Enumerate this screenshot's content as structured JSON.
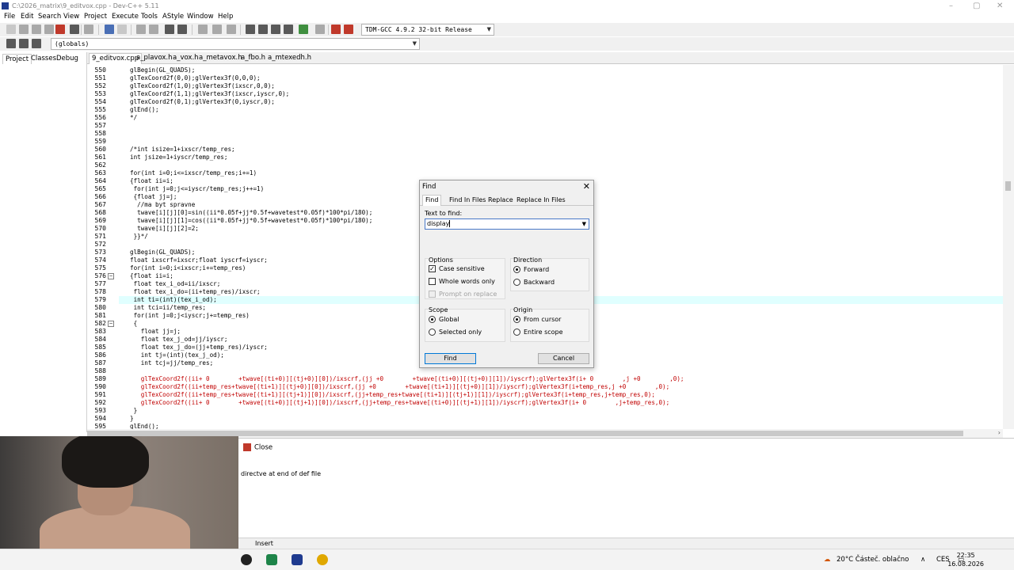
{
  "window": {
    "title": "C:\\2026_matrix\\9_editvox.cpp - Dev-C++ 5.11",
    "controls": [
      "–",
      "▢",
      "✕"
    ]
  },
  "menu": [
    "File",
    "Edit",
    "Search",
    "View",
    "Project",
    "Execute",
    "Tools",
    "AStyle",
    "Window",
    "Help"
  ],
  "toolbar": {
    "compiler": "TDM-GCC 4.9.2 32-bit Release",
    "scope": "(globals)"
  },
  "left_panel": {
    "tabs": [
      "Project",
      "Classes",
      "Debug"
    ]
  },
  "editor_tabs": [
    "9_editvox.cpp",
    "a_plavox.h",
    "a_vox.h",
    "a_metavox.h",
    "a_fbo.h",
    "a_mtexedh.h"
  ],
  "code_lines": [
    {
      "n": "550",
      "text": "glBegin(GL_QUADS);"
    },
    {
      "n": "551",
      "text": "glTexCoord2f(0,0);glVertex3f(0,0,0);"
    },
    {
      "n": "552",
      "text": "glTexCoord2f(1,0);glVertex3f(ixscr,0,0);"
    },
    {
      "n": "553",
      "text": "glTexCoord2f(1,1);glVertex3f(ixscr,iyscr,0);"
    },
    {
      "n": "554",
      "text": "glTexCoord2f(0,1);glVertex3f(0,iyscr,0);"
    },
    {
      "n": "555",
      "text": "glEnd();"
    },
    {
      "n": "556",
      "text": "*/"
    },
    {
      "n": "557",
      "text": ""
    },
    {
      "n": "558",
      "text": ""
    },
    {
      "n": "559",
      "text": ""
    },
    {
      "n": "560",
      "text": "/*int isize=1+ixscr/temp_res;"
    },
    {
      "n": "561",
      "text": "int jsize=1+iyscr/temp_res;"
    },
    {
      "n": "562",
      "text": ""
    },
    {
      "n": "563",
      "text": "for(int i=0;i<=ixscr/temp_res;i+=1)"
    },
    {
      "n": "564",
      "text": "{float ii=i;"
    },
    {
      "n": "565",
      "text": " for(int j=0;j<=iyscr/temp_res;j++=1)"
    },
    {
      "n": "566",
      "text": " {float jj=j;"
    },
    {
      "n": "567",
      "text": "  //ma byt spravne"
    },
    {
      "n": "568",
      "text": "  twave[i][j][0]=sin((ii*0.05f+jj*0.5f+wavetest*0.05f)*100*pi/180);"
    },
    {
      "n": "569",
      "text": "  twave[i][j][1]=cos((ii*0.05f+jj*0.5f+wavetest*0.05f)*100*pi/180);"
    },
    {
      "n": "570",
      "text": "  twave[i][j][2]=2;"
    },
    {
      "n": "571",
      "text": " }}*/"
    },
    {
      "n": "572",
      "text": ""
    },
    {
      "n": "573",
      "text": "glBegin(GL_QUADS);"
    },
    {
      "n": "574",
      "text": "float ixscrf=ixscr;float iyscrf=iyscr;"
    },
    {
      "n": "575",
      "text": "for(int i=0;i<ixscr;i+=temp_res)"
    },
    {
      "n": "576",
      "text": "{float ii=i;"
    },
    {
      "n": "577",
      "text": " float tex_i_od=ii/ixscr;"
    },
    {
      "n": "578",
      "text": " float tex_i_do=(ii+temp_res)/ixscr;"
    },
    {
      "n": "579",
      "text": " int ti=(int)(tex_i_od);"
    },
    {
      "n": "580",
      "text": " int tci=ii/temp_res;"
    },
    {
      "n": "581",
      "text": " for(int j=0;j<iyscr;j+=temp_res)"
    },
    {
      "n": "582",
      "text": " {"
    },
    {
      "n": "583",
      "text": "   float jj=j;"
    },
    {
      "n": "584",
      "text": "   float tex_j_od=jj/iyscr;"
    },
    {
      "n": "585",
      "text": "   float tex_j_do=(jj+temp_res)/iyscr;"
    },
    {
      "n": "586",
      "text": "   int tj=(int)(tex_j_od);"
    },
    {
      "n": "587",
      "text": "   int tcj=jj/temp_res;"
    },
    {
      "n": "588",
      "text": ""
    },
    {
      "n": "589",
      "text": "   glTexCoord2f((ii+ 0        +twave[(ti+0)][(tj+0)][0])/ixscrf,(jj +0        +twave[(ti+0)][(tj+0)][1])/iyscrf);glVertex3f(i+ 0        ,j +0        ,0);"
    },
    {
      "n": "590",
      "text": "   glTexCoord2f((ii+temp_res+twave[(ti+1)][(tj+0)][0])/ixscrf,(jj +0        +twave[(ti+1)][(tj+0)][1])/iyscrf);glVertex3f(i+temp_res,j +0        ,0);"
    },
    {
      "n": "591",
      "text": "   glTexCoord2f((ii+temp_res+twave[(ti+1)][(tj+1)][0])/ixscrf,(jj+temp_res+twave[(ti+1)][(tj+1)][1])/iyscrf);glVertex3f(i+temp_res,j+temp_res,0);"
    },
    {
      "n": "592",
      "text": "   glTexCoord2f((ii+ 0        +twave[(ti+0)][(tj+1)][0])/ixscrf,(jj+temp_res+twave[(ti+0)][(tj+1)][1])/iyscrf);glVertex3f(i+ 0        ,j+temp_res,0);"
    },
    {
      "n": "593",
      "text": " }"
    },
    {
      "n": "594",
      "text": "}"
    },
    {
      "n": "595",
      "text": "glEnd();"
    }
  ],
  "find_dialog": {
    "title": "Find",
    "close": "✕",
    "tabs": [
      "Find",
      "Find In Files",
      "Replace",
      "Replace In Files"
    ],
    "text_to_find_label": "Text to find:",
    "text_to_find_value": "display",
    "options_title": "Options",
    "case_sensitive": "Case sensitive",
    "whole_words": "Whole words only",
    "prompt_on_replace": "Prompt on replace",
    "direction_title": "Direction",
    "forward": "Forward",
    "backward": "Backward",
    "scope_title": "Scope",
    "global": "Global",
    "selected_only": "Selected only",
    "origin_title": "Origin",
    "from_cursor": "From cursor",
    "entire_scope": "Entire scope",
    "find_button": "Find",
    "cancel_button": "Cancel",
    "case_sensitive_checked": true,
    "whole_words_checked": false
  },
  "bottom_panel": {
    "close_label": "Close",
    "message": "directve at end of def file"
  },
  "status": {
    "mode": "Insert"
  },
  "taskbar": {
    "weather": "20°C  Částeč. oblačno",
    "lang": "CES",
    "time": "22:35",
    "date": "16.08.2026"
  }
}
